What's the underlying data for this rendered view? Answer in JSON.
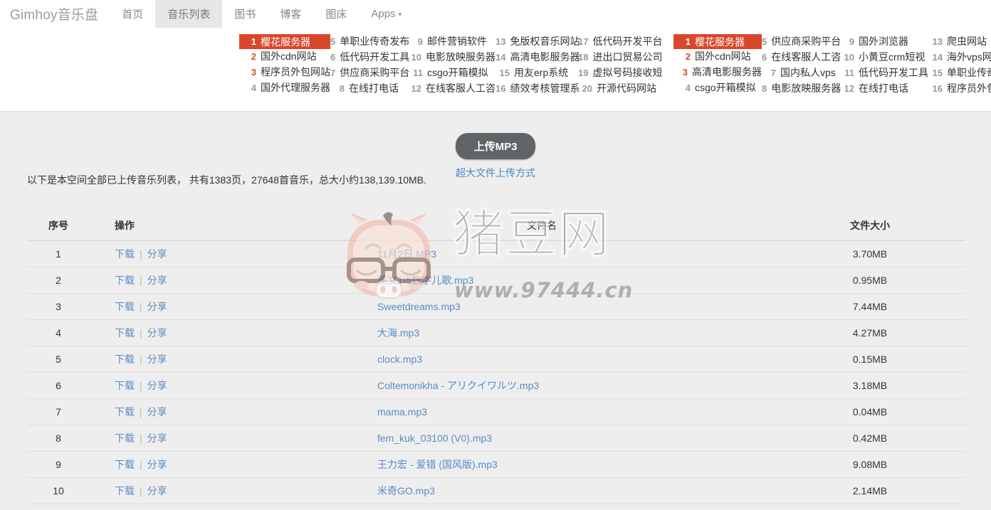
{
  "navbar": {
    "brand": "Gimhoy音乐盘",
    "items": [
      {
        "label": "首页",
        "active": false
      },
      {
        "label": "音乐列表",
        "active": true
      },
      {
        "label": "图书",
        "active": false
      },
      {
        "label": "博客",
        "active": false
      },
      {
        "label": "图床",
        "active": false
      },
      {
        "label": "Apps",
        "active": false,
        "caret": true
      }
    ],
    "caret_glyph": "▾"
  },
  "ads": {
    "close_glyph": "✕",
    "highlight_color": "#d9472b",
    "block_left": {
      "columns": [
        [
          {
            "num": "1",
            "text": "樱花服务器",
            "style": "first"
          },
          {
            "num": "2",
            "text": "国外cdn网站",
            "style": "hot"
          },
          {
            "num": "3",
            "text": "程序员外包网站",
            "style": "hot"
          },
          {
            "num": "4",
            "text": "国外代理服务器",
            "style": "normal"
          }
        ],
        [
          {
            "num": "5",
            "text": "单职业传奇发布",
            "style": "normal"
          },
          {
            "num": "6",
            "text": "低代码开发工具",
            "style": "normal"
          },
          {
            "num": "7",
            "text": "供应商采购平台",
            "style": "normal"
          },
          {
            "num": "8",
            "text": "在线打电话",
            "style": "normal"
          }
        ],
        [
          {
            "num": "9",
            "text": "邮件营销软件",
            "style": "normal"
          },
          {
            "num": "10",
            "text": "电影放映服务器",
            "style": "normal"
          },
          {
            "num": "11",
            "text": "csgo开箱模拟",
            "style": "normal"
          },
          {
            "num": "12",
            "text": "在线客服人工咨",
            "style": "normal"
          }
        ],
        [
          {
            "num": "13",
            "text": "免版权音乐网站",
            "style": "normal"
          },
          {
            "num": "14",
            "text": "高清电影服务器",
            "style": "normal"
          },
          {
            "num": "15",
            "text": "用友erp系统",
            "style": "normal"
          },
          {
            "num": "16",
            "text": "绩效考核管理系",
            "style": "normal"
          }
        ],
        [
          {
            "num": "17",
            "text": "低代码开发平台",
            "style": "normal"
          },
          {
            "num": "18",
            "text": "进出口贸易公司",
            "style": "normal"
          },
          {
            "num": "19",
            "text": "虚拟号码接收短",
            "style": "normal"
          },
          {
            "num": "20",
            "text": "开源代码网站",
            "style": "normal"
          }
        ]
      ]
    },
    "block_right": {
      "columns": [
        [
          {
            "num": "1",
            "text": "樱花服务器",
            "style": "first"
          },
          {
            "num": "2",
            "text": "国外cdn网站",
            "style": "hot"
          },
          {
            "num": "3",
            "text": "高清电影服务器",
            "style": "hot"
          },
          {
            "num": "4",
            "text": "csgo开箱模拟",
            "style": "normal"
          }
        ],
        [
          {
            "num": "5",
            "text": "供应商采购平台",
            "style": "normal"
          },
          {
            "num": "6",
            "text": "在线客服人工咨",
            "style": "normal"
          },
          {
            "num": "7",
            "text": "国内私人vps",
            "style": "normal"
          },
          {
            "num": "8",
            "text": "电影放映服务器",
            "style": "normal"
          }
        ],
        [
          {
            "num": "9",
            "text": "国外浏览器",
            "style": "normal"
          },
          {
            "num": "10",
            "text": "小黄豆crm短视",
            "style": "normal"
          },
          {
            "num": "11",
            "text": "低代码开发工具",
            "style": "normal"
          },
          {
            "num": "12",
            "text": "在线打电话",
            "style": "normal"
          }
        ],
        [
          {
            "num": "13",
            "text": "爬虫网站",
            "style": "normal"
          },
          {
            "num": "14",
            "text": "海外vps网站",
            "style": "normal"
          },
          {
            "num": "15",
            "text": "单职业传奇发",
            "style": "normal"
          },
          {
            "num": "16",
            "text": "程序员外包网",
            "style": "normal"
          }
        ]
      ]
    }
  },
  "main": {
    "upload_button": "上传MP3",
    "upload_link": "超大文件上传方式",
    "summary": "以下是本空间全部已上传音乐列表， 共有1383页，27648首音乐，总大小约138,139.10MB."
  },
  "table": {
    "headers": {
      "index": "序号",
      "operation": "操作",
      "filename": "文件名",
      "filesize": "文件大小"
    },
    "op_download": "下载",
    "op_separator": "|",
    "op_share": "分享",
    "rows": [
      {
        "index": "1",
        "filename": "11月2日.MP3",
        "filesize": "3.70MB"
      },
      {
        "index": "2",
        "filename": "英文1-5数字儿歌.mp3",
        "filesize": "0.95MB"
      },
      {
        "index": "3",
        "filename": "Sweetdreams.mp3",
        "filesize": "7.44MB"
      },
      {
        "index": "4",
        "filename": "大海.mp3",
        "filesize": "4.27MB"
      },
      {
        "index": "5",
        "filename": "clock.mp3",
        "filesize": "0.15MB"
      },
      {
        "index": "6",
        "filename": "Coltemonikha - アリクイワルツ.mp3",
        "filesize": "3.18MB"
      },
      {
        "index": "7",
        "filename": "mama.mp3",
        "filesize": "0.04MB"
      },
      {
        "index": "8",
        "filename": "fem_kuk_03100 (V0).mp3",
        "filesize": "0.42MB"
      },
      {
        "index": "9",
        "filename": "王力宏 - 爱错 (国风版).mp3",
        "filesize": "9.08MB"
      },
      {
        "index": "10",
        "filename": "米奇GO.mp3",
        "filesize": "2.14MB"
      }
    ]
  },
  "watermark": {
    "text": "猪豆网",
    "url": "www.97444.cn"
  }
}
